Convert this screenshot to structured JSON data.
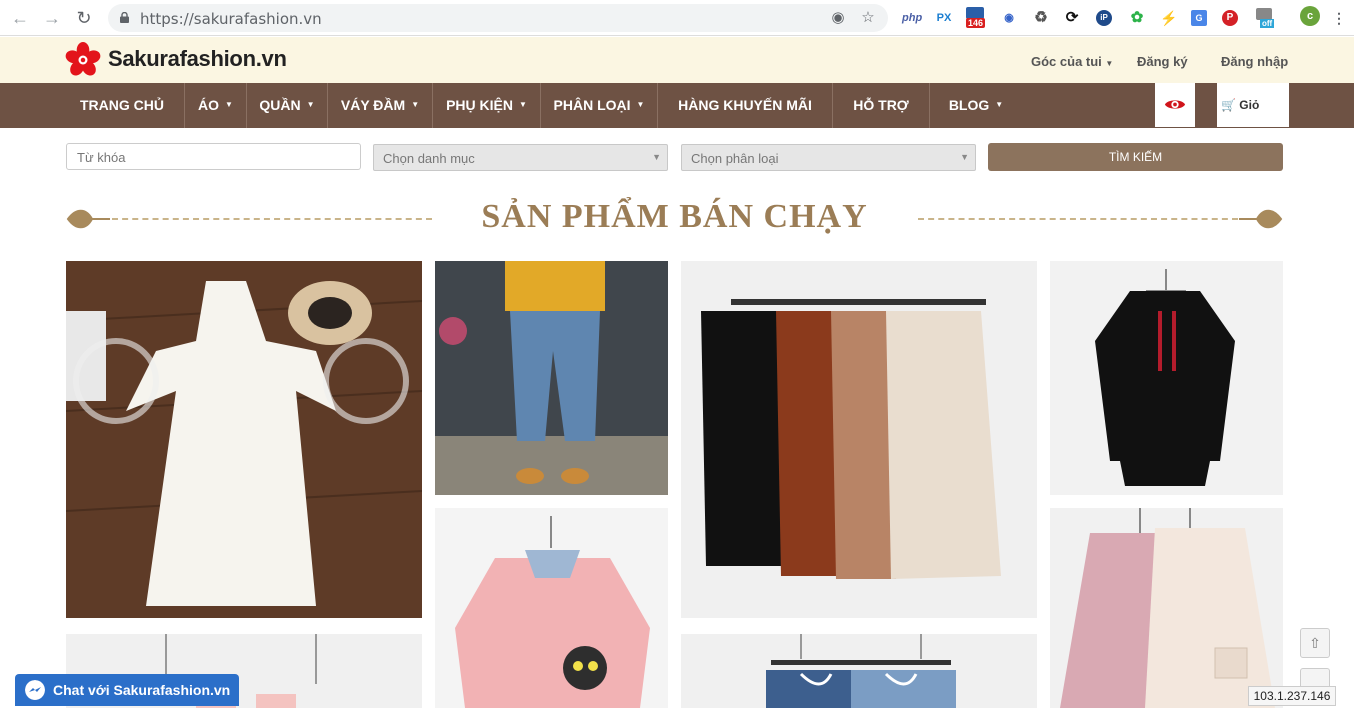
{
  "browser": {
    "url": "https://sakurafashion.vn",
    "badge_count": "146",
    "ext_off_label": "off",
    "profile_letter": "c"
  },
  "site": {
    "logo_text": "Sakurafashion.vn",
    "top_links": [
      "Góc của tui",
      "Đăng ký",
      "Đăng nhập"
    ]
  },
  "nav": {
    "items": [
      {
        "label": "TRANG CHỦ",
        "caret": false
      },
      {
        "label": "ÁO",
        "caret": true
      },
      {
        "label": "QUẦN",
        "caret": true
      },
      {
        "label": "VÁY ĐẦM",
        "caret": true
      },
      {
        "label": "PHỤ KIỆN",
        "caret": true
      },
      {
        "label": "PHÂN LOẠI",
        "caret": true
      },
      {
        "label": "HÀNG KHUYẾN MÃI",
        "caret": false
      },
      {
        "label": "HỖ TRỢ",
        "caret": false
      },
      {
        "label": "BLOG",
        "caret": true
      }
    ],
    "cart_label": "Giỏ hàng"
  },
  "search": {
    "keyword_placeholder": "Từ khóa",
    "category_select": "Chọn danh mục",
    "type_select": "Chọn phân loại",
    "button_label": "TÌM KIẾM"
  },
  "section": {
    "title": "SẢN PHẨM BÁN CHẠY"
  },
  "products": [
    {
      "icon": "white-floral-dress-image"
    },
    {
      "icon": "jeans-yellow-top-image"
    },
    {
      "icon": "wide-pants-colors-image"
    },
    {
      "icon": "black-hoodie-dress-image"
    },
    {
      "icon": "pink-sweater-cat-image"
    },
    {
      "icon": "pink-hooded-coats-image"
    },
    {
      "icon": "hanging-item-image"
    },
    {
      "icon": "denim-shorts-image"
    }
  ],
  "chat": {
    "label": "Chat với Sakurafashion.vn"
  },
  "status": {
    "ip": "103.1.237.146"
  },
  "colors": {
    "nav_bg": "#6e5244",
    "topbar_bg": "#fbf6e2",
    "accent": "#9b7d56",
    "search_btn": "#8c735d",
    "chat_bg": "#2b6fc9"
  }
}
